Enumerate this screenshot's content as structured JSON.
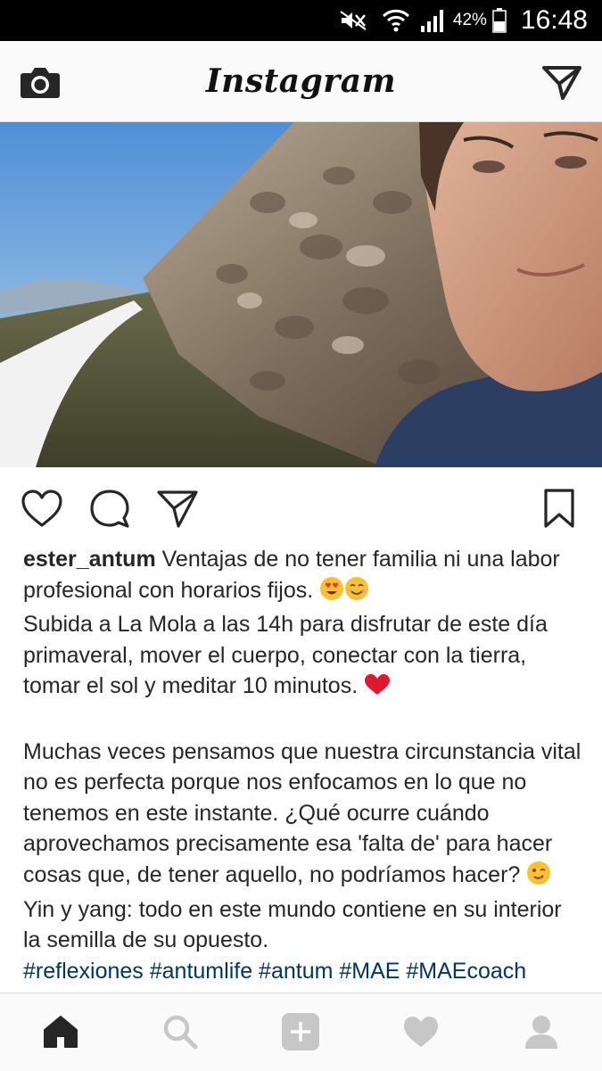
{
  "status_bar": {
    "battery_percent": "42%",
    "time": "16:48",
    "icons": [
      "mute-icon",
      "wifi-icon",
      "signal-icon",
      "battery-icon"
    ]
  },
  "header": {
    "title": "Instagram",
    "left_icon": "camera-icon",
    "right_icon": "direct-message-icon"
  },
  "post": {
    "actions": [
      "heart-icon",
      "comment-icon",
      "share-icon",
      "bookmark-icon"
    ],
    "username": "ester_antum",
    "caption_lines": {
      "p1": "Ventajas de no tener familia ni una labor profesional con horarios fijos.",
      "p2": "Subida a La Mola a las 14h para disfrutar de este día primaveral, mover el cuerpo, conectar con la tierra, tomar el sol y meditar 10 minutos.",
      "p3": "Muchas veces pensamos que nuestra circunstancia vital no es perfecta porque nos enfocamos en lo que no tenemos en este instante. ¿Qué ocurre cuándo aprovechamos precisamente esa 'falta de' para hacer cosas que, de tener aquello, no podríamos hacer?",
      "p4": "Yin y yang: todo en este mundo contiene en su interior la semilla de su opuesto.",
      "hashtags": "#reflexiones #antumlife #antum #MAE #MAEcoach"
    },
    "emojis": [
      "heart-eyes-emoji",
      "smiling-emoji",
      "red-heart-emoji",
      "winking-emoji"
    ]
  },
  "bottom_nav": {
    "items": [
      "home-icon",
      "search-icon",
      "add-icon",
      "activity-heart-icon",
      "profile-icon"
    ],
    "active": "home-icon"
  }
}
